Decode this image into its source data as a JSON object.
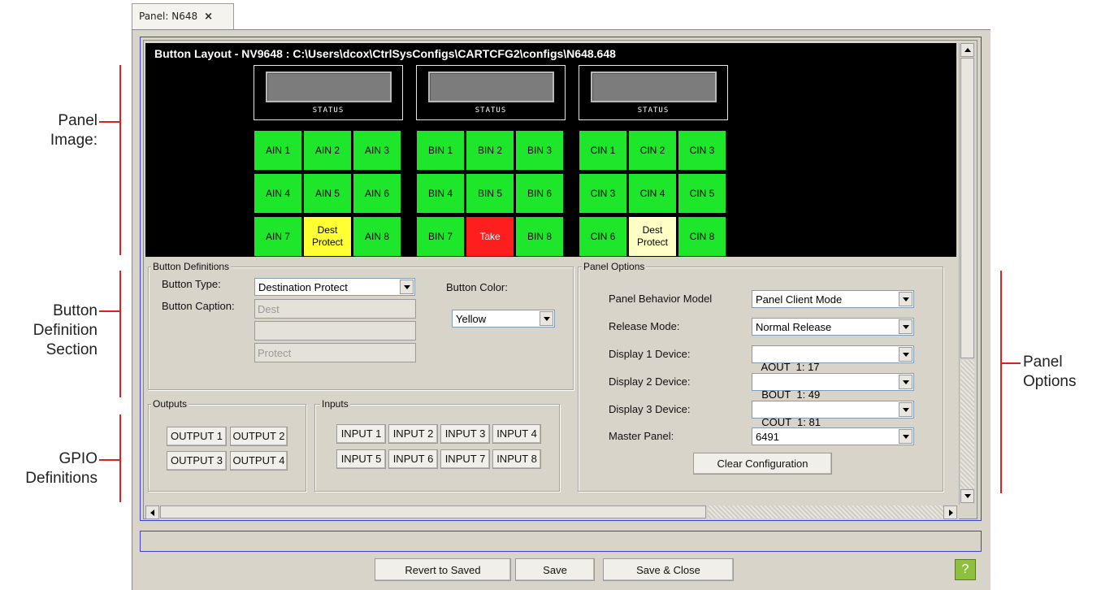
{
  "tab": {
    "title": "Panel: N648",
    "close": "×"
  },
  "callouts": {
    "panel_image_1": "Panel",
    "panel_image_2": "Image:",
    "button_def_1": "Button",
    "button_def_2": "Definition",
    "button_def_3": "Section",
    "gpio_1": "GPIO",
    "gpio_2": "Definitions",
    "panel_options_1": "Panel",
    "panel_options_2": "Options"
  },
  "button_layout": {
    "title": "Button Layout - NV9648 : C:\\Users\\dcox\\CtrlSysConfigs\\CARTCFG2\\configs\\N648.648",
    "status_label": "STATUS",
    "groups": [
      {
        "rows": [
          [
            "AIN 1",
            "AIN 2",
            "AIN 3"
          ],
          [
            "AIN 4",
            "AIN 5",
            "AIN 6"
          ],
          [
            "AIN 7",
            "Dest\nProtect",
            "AIN 8"
          ]
        ]
      },
      {
        "rows": [
          [
            "BIN 1",
            "BIN 2",
            "BIN 3"
          ],
          [
            "BIN 4",
            "BIN 5",
            "BIN 6"
          ],
          [
            "BIN 7",
            "Take",
            "BIN 8"
          ]
        ]
      },
      {
        "rows": [
          [
            "CIN 1",
            "CIN 2",
            "CIN 3"
          ],
          [
            "CIN 3",
            "CIN 4",
            "CIN 5"
          ],
          [
            "CIN 6",
            "Dest\nProtect",
            "CIN 8"
          ]
        ]
      }
    ],
    "colors": {
      "green": "#1ee62b",
      "yellow": "#ffff33",
      "pale_yellow": "#ffffc6",
      "red": "#ff1e1e"
    }
  },
  "button_definitions": {
    "title": "Button Definitions",
    "type_label": "Button Type:",
    "type_value": "Destination Protect",
    "caption_label": "Button Caption:",
    "caption_lines": [
      "Dest",
      "",
      "Protect"
    ],
    "color_label": "Button Color:",
    "color_value": "Yellow"
  },
  "outputs": {
    "title": "Outputs",
    "buttons": [
      "OUTPUT 1",
      "OUTPUT 2",
      "OUTPUT 3",
      "OUTPUT 4"
    ]
  },
  "inputs": {
    "title": "Inputs",
    "buttons": [
      "INPUT 1",
      "INPUT 2",
      "INPUT 3",
      "INPUT 4",
      "INPUT 5",
      "INPUT 6",
      "INPUT 7",
      "INPUT 8"
    ]
  },
  "panel_options": {
    "title": "Panel Options",
    "rows": [
      {
        "label": "Panel Behavior Model",
        "value": "Panel Client Mode"
      },
      {
        "label": "Release Mode:",
        "value": "Normal Release"
      },
      {
        "label": "Display 1 Device:",
        "value": "AOUT  1: 17"
      },
      {
        "label": "Display 2 Device:",
        "value": "BOUT  1: 49"
      },
      {
        "label": "Display 3 Device:",
        "value": "COUT  1: 81"
      },
      {
        "label": "Master Panel:",
        "value": "6491"
      }
    ],
    "clear_button": "Clear Configuration"
  },
  "footer": {
    "revert": "Revert to Saved",
    "save": "Save",
    "save_close": "Save & Close",
    "help": "?"
  }
}
